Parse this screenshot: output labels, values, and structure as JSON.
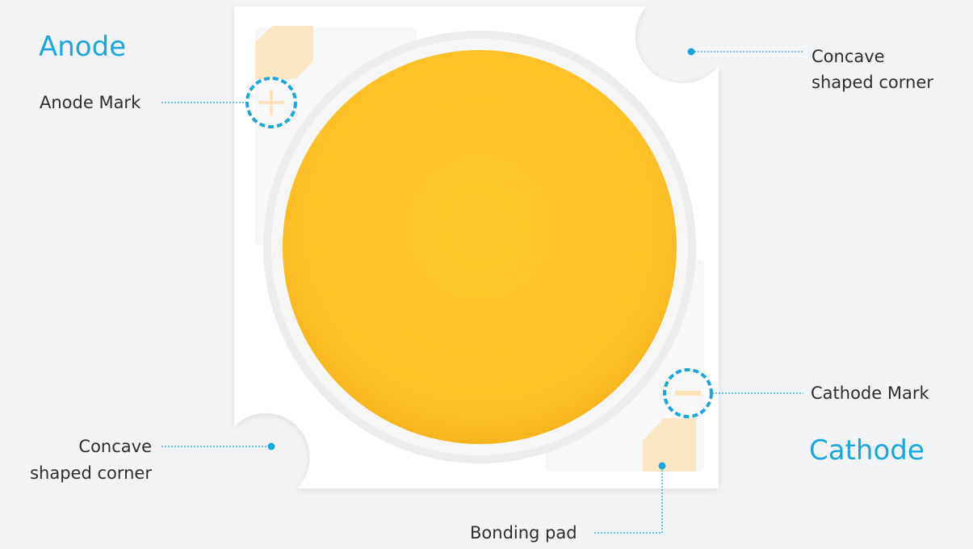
{
  "labels": {
    "anode": "Anode",
    "anode_mark": "Anode Mark",
    "concave_top_line1": "Concave",
    "concave_top_line2": "shaped corner",
    "cathode_mark": "Cathode Mark",
    "cathode": "Cathode",
    "concave_bottom_line1": "Concave",
    "concave_bottom_line2": "shaped corner",
    "bonding_pad": "Bonding pad"
  },
  "colors": {
    "background": "#f2f3f5",
    "substrate": "#ffffff",
    "phosphor": "#fdc72a",
    "ring": "#eeeeee",
    "pad": "#fbe6c4",
    "accent": "#1ba7dc",
    "text": "#2e2e2e"
  },
  "icons": {
    "anode_mark": "plus-icon",
    "cathode_mark": "minus-icon"
  }
}
